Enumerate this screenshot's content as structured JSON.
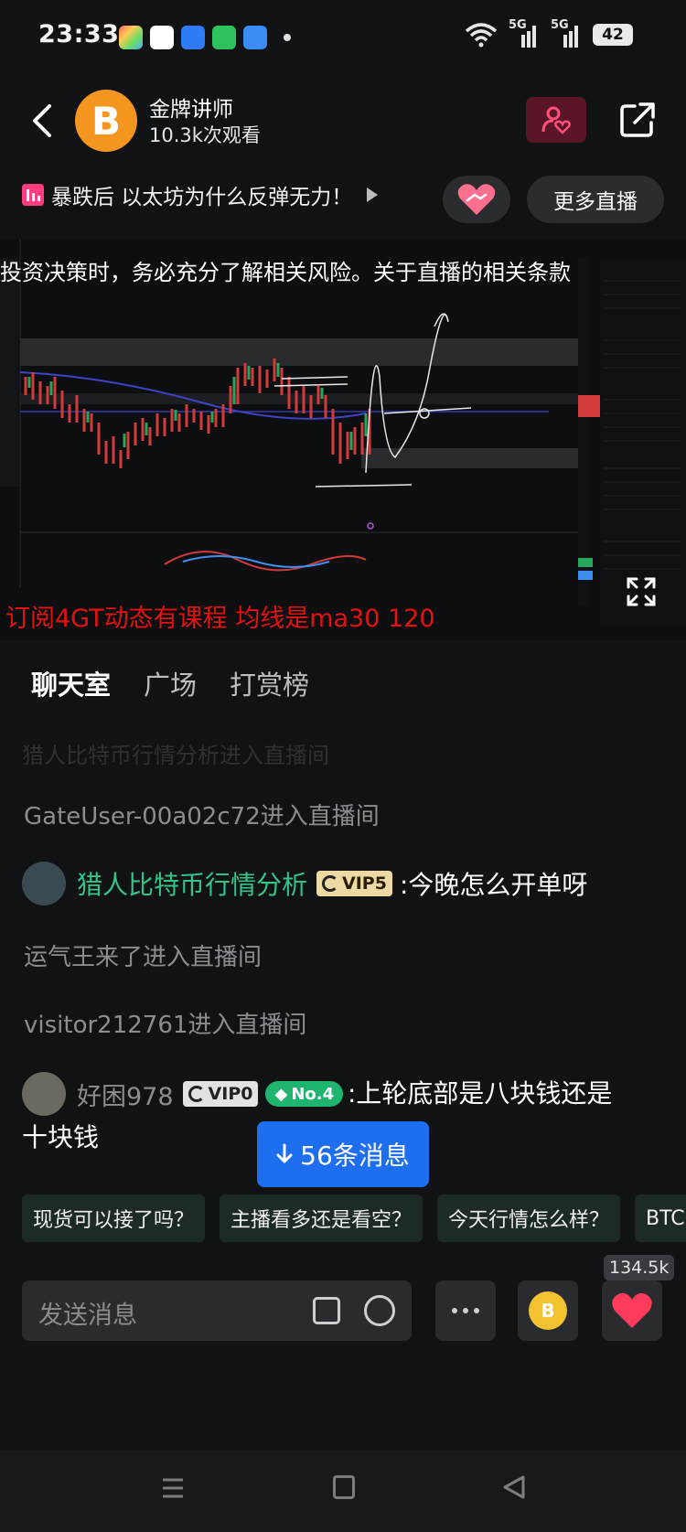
{
  "status_bar": {
    "time": "23:33",
    "network_1": "5G",
    "network_2": "5G",
    "battery": "42"
  },
  "header": {
    "avatar_symbol": "B",
    "name": "金牌讲师",
    "views": "10.3k次观看"
  },
  "topic": {
    "title": "暴跌后 以太坊为什么反弹无力！",
    "more_live_label": "更多直播"
  },
  "video": {
    "disclaimer": "投资决策时，务必充分了解相关风险。关于直播的相关条款",
    "overlay_text": "订阅4GT动态有课程  均线是ma30 120"
  },
  "tabs": [
    {
      "label": "聊天室"
    },
    {
      "label": "广场"
    },
    {
      "label": "打赏榜"
    }
  ],
  "chat": {
    "faded_line": "猎人比特币行情分析进入直播间",
    "messages": [
      {
        "type": "system",
        "text": "GateUser-00a02c72进入直播间"
      },
      {
        "type": "user",
        "name": "猎人比特币行情分析",
        "vip": "VIP5",
        "text": ":今晚怎么开单呀"
      },
      {
        "type": "system",
        "text": "运气王来了进入直播间"
      },
      {
        "type": "system",
        "text": "visitor212761进入直播间"
      },
      {
        "type": "user",
        "name": "好困978",
        "vip": "VIP0",
        "rank": "No.4",
        "text": ":上轮底部是八块钱还是十块钱"
      }
    ],
    "new_messages_label": "56条消息"
  },
  "quick_replies": [
    "现货可以接了吗？",
    "主播看多还是看空？",
    "今天行情怎么样？",
    "BTC"
  ],
  "input": {
    "placeholder": "发送消息",
    "coin_symbol": "B",
    "like_count": "134.5k"
  },
  "colors": {
    "background": "#111214",
    "accent_blue": "#1e6ff0",
    "vip_gold": "#ecd9a4",
    "green_name": "#33c48a",
    "like_red": "#ff3b5c"
  }
}
